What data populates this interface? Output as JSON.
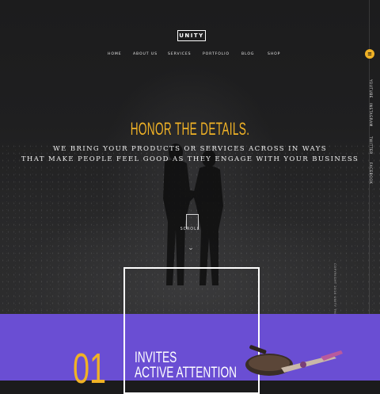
{
  "brand": {
    "logo_text": "UNITY"
  },
  "nav": {
    "items": [
      {
        "label": "HOME"
      },
      {
        "label": "ABOUT US"
      },
      {
        "label": "SERVICES"
      },
      {
        "label": "PORTFOLIO"
      },
      {
        "label": "BLOG"
      },
      {
        "label": "SHOP"
      }
    ]
  },
  "hero": {
    "headline": "HONOR THE DETAILS.",
    "subline_1": "WE BRING YOUR PRODUCTS OR SERVICES ACROSS IN WAYS",
    "subline_2": "THAT MAKE PEOPLE FEEL GOOD AS THEY ENGAGE WITH YOUR BUSINESS",
    "scroll_label": "SCROLL"
  },
  "side": {
    "menu_icon": "menu-icon",
    "social": [
      "YOUTUBE",
      "INSTAGRAM",
      "TWITTER",
      "FACEBOOK"
    ],
    "copyright": "COPYRIGHT 2016 UNITY THEME"
  },
  "feature": {
    "number": "01",
    "title_1": "INVITES",
    "title_2": "ACTIVE ATTENTION"
  },
  "colors": {
    "accent": "#f0b226",
    "purple": "#6a4ed3",
    "dark": "#1b1b1c"
  }
}
